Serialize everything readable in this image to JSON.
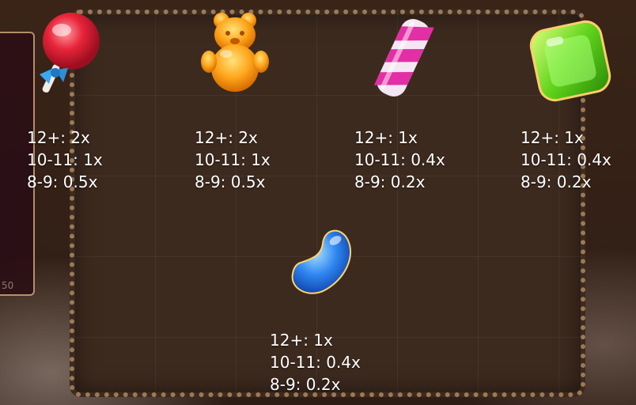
{
  "side_panel": {
    "value": "50"
  },
  "symbols": [
    {
      "icon": "lollipop-icon",
      "paytable": [
        "12+: 2x",
        "10-11: 1x",
        "8-9: 0.5x"
      ]
    },
    {
      "icon": "gummy-bear-icon",
      "paytable": [
        "12+: 2x",
        "10-11: 1x",
        "8-9: 0.5x"
      ]
    },
    {
      "icon": "candy-stick-icon",
      "paytable": [
        "12+: 1x",
        "10-11: 0.4x",
        "8-9: 0.2x"
      ]
    },
    {
      "icon": "green-candy-icon",
      "paytable": [
        "12+: 1x",
        "10-11: 0.4x",
        "8-9: 0.2x"
      ]
    },
    {
      "icon": "jelly-bean-icon",
      "paytable": [
        "12+: 1x",
        "10-11: 0.4x",
        "8-9: 0.2x"
      ]
    }
  ]
}
